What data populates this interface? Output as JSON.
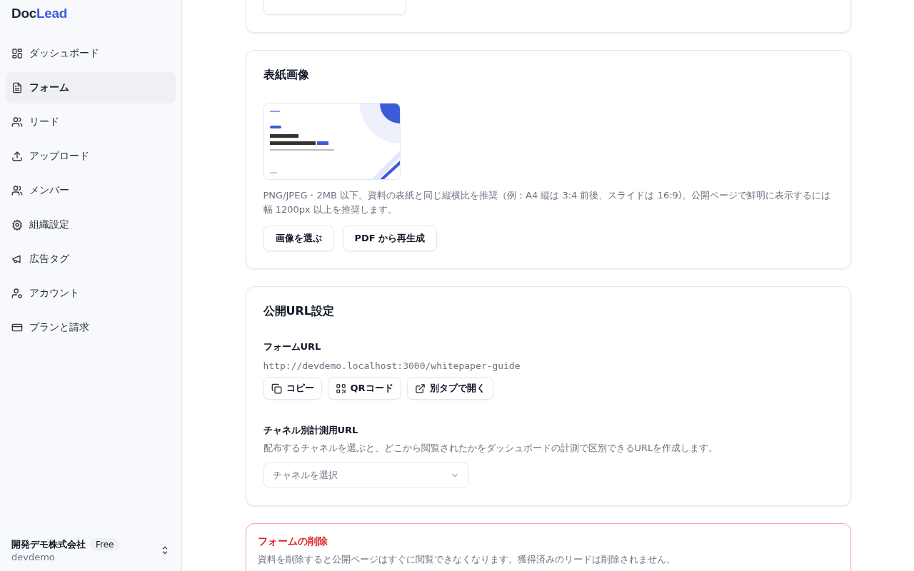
{
  "sidebar": {
    "logo": {
      "part_1": "Doc",
      "part_2": "Lead"
    },
    "items": [
      {
        "label": "ダッシュボード",
        "kind": "grid",
        "selected": false
      },
      {
        "label": "フォーム",
        "kind": "document",
        "selected": true
      },
      {
        "label": "リード",
        "kind": "users",
        "selected": false
      },
      {
        "label": "アップロード",
        "kind": "upload",
        "selected": false
      },
      {
        "label": "メンバー",
        "kind": "users",
        "selected": false
      },
      {
        "label": "組織設定",
        "kind": "gear",
        "selected": false
      },
      {
        "label": "広告タグ",
        "kind": "megaphone",
        "selected": false
      },
      {
        "label": "アカウント",
        "kind": "user",
        "selected": false
      },
      {
        "label": "プランと請求",
        "kind": "card",
        "selected": false
      }
    ],
    "org": {
      "name": "開発デモ株式会社",
      "plan": "Free",
      "slug": "devdemo"
    }
  },
  "cover_card": {
    "title": "表紙画像",
    "image": {
      "kind": "picture"
    },
    "hint": "PNG/JPEG・2MB 以下。資料の表紙と同じ縦横比を推奨（例：A4 縦は 3:4 前後、スライドは 16:9)。公開ページで鮮明に表示するには幅 1200px 以上を推奨します。",
    "buttons": [
      "画像を選ぶ",
      "PDF から再生成"
    ]
  },
  "url_card": {
    "title": "公開URL設定",
    "form_url_label": "フォームURL",
    "form_url": "http://devdemo.localhost:3000/whitepaper-guide",
    "buttons": [
      {
        "label": "コピー",
        "kind": "copy"
      },
      {
        "label": "QRコード",
        "kind": "qr"
      },
      {
        "label": "別タブで開く",
        "kind": "external"
      }
    ],
    "channel_label": "チャネル別計測用URL",
    "channel_hint": "配布するチャネルを選ぶと、どこから閲覧されたかをダッシュボードの計測で区別できるURLを作成します。",
    "channel_select": {
      "placeholder": "チャネルを選択"
    }
  },
  "delete_card": {
    "title": "フォームの削除",
    "text": "資料を削除すると公開ページはすぐに閲覧できなくなります。獲得済みのリードは削除されません。"
  }
}
